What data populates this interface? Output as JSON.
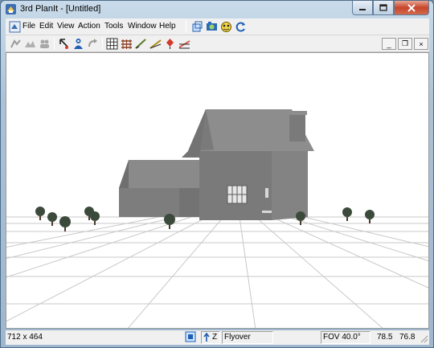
{
  "window": {
    "title": "3rd PlanIt - [Untitled]"
  },
  "menu": {
    "items": [
      {
        "label": "File"
      },
      {
        "label": "Edit"
      },
      {
        "label": "View"
      },
      {
        "label": "Action"
      },
      {
        "label": "Tools"
      },
      {
        "label": "Window"
      },
      {
        "label": "Help"
      }
    ]
  },
  "toolbar": {
    "icons": [
      "new-view-icon",
      "camera-icon",
      "rotate-icon",
      "refresh-icon",
      "walk-icon",
      "terrain-icon",
      "people-icon",
      "pointer-icon",
      "person-icon",
      "redo-icon",
      "grid-icon",
      "fence-icon",
      "line-tool-icon",
      "slope-icon",
      "pin-icon",
      "section-icon"
    ]
  },
  "mdi": {
    "minimize": "_",
    "restore": "❐",
    "close": "×"
  },
  "status": {
    "size": "712 x 464",
    "axis": "Z",
    "mode": "Flyover",
    "fov": "FOV 40.0°",
    "coord_a": "78.5",
    "coord_b": "76.8"
  },
  "colors": {
    "house": "#7b7b7b",
    "roof": "#8a8a8a",
    "grid": "#c8c8c8",
    "tree": "#3c4a3c",
    "close_btn": "#c7462b"
  }
}
